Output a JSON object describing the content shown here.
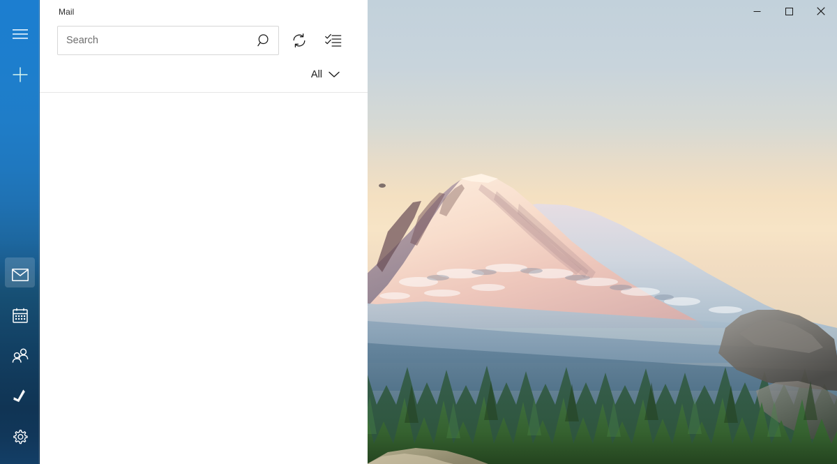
{
  "window": {
    "title": "Mail",
    "controls": [
      {
        "name": "minimize",
        "label": "—",
        "icon": "minimize-icon"
      },
      {
        "name": "maximize",
        "label": "□",
        "icon": "maximize-icon"
      },
      {
        "name": "close",
        "label": "✕",
        "icon": "close-icon"
      }
    ]
  },
  "sidebar": {
    "top_items": [
      {
        "icon": "hamburger-menu-icon",
        "label": "Navigation",
        "selected": false
      },
      {
        "icon": "plus-icon",
        "label": "New mail",
        "selected": false
      }
    ],
    "bottom_items": [
      {
        "icon": "mail-icon",
        "label": "Mail",
        "selected": true
      },
      {
        "icon": "calendar-icon",
        "label": "Calendar",
        "selected": false
      },
      {
        "icon": "people-icon",
        "label": "People",
        "selected": false
      },
      {
        "icon": "todo-icon",
        "label": "To Do",
        "selected": false
      },
      {
        "icon": "gear-icon",
        "label": "Settings",
        "selected": false
      }
    ]
  },
  "command_bar": {
    "search": {
      "value": "",
      "placeholder": "Search",
      "icon": "search-icon"
    },
    "buttons": [
      {
        "icon": "sync-icon",
        "label": "Sync this view"
      },
      {
        "icon": "selection-mode-icon",
        "label": "Enter selection mode"
      }
    ],
    "filter": {
      "label": "All",
      "icon": "chevron-down-icon"
    }
  },
  "message_list": {
    "items": [],
    "empty": true
  },
  "colors": {
    "accent_blue": "#1c7ed0",
    "rail_bottom": "#133e66",
    "pane_background": "#ffffff",
    "divider": "#e6e6e6",
    "search_border": "#d6d6d6",
    "text_primary": "#1b1b1b",
    "text_placeholder": "#6e6e6e"
  },
  "wallpaper": {
    "scene": "mount-rainier-sunset-evergreen-forest",
    "sky_top": "#c3d2dc",
    "sky_horizon": "#f6e2c2",
    "snow_highlight": "#f7d9c4",
    "forest_green": "#3f6b3a"
  }
}
